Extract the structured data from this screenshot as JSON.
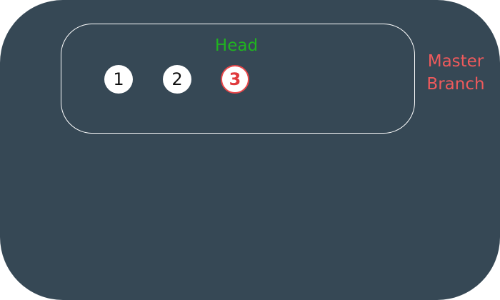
{
  "diagram": {
    "branch_label_line1": "Master",
    "branch_label_line2": "Branch",
    "head_label": "Head",
    "commits": [
      "1",
      "2",
      "3"
    ],
    "head_commit_index": 2,
    "colors": {
      "background": "#364855",
      "branch_outline": "#ffffff",
      "commit_fill": "#ffffff",
      "head_label": "#20b320",
      "branch_label": "#ee5a5c",
      "head_commit_accent": "#e0393c"
    }
  }
}
